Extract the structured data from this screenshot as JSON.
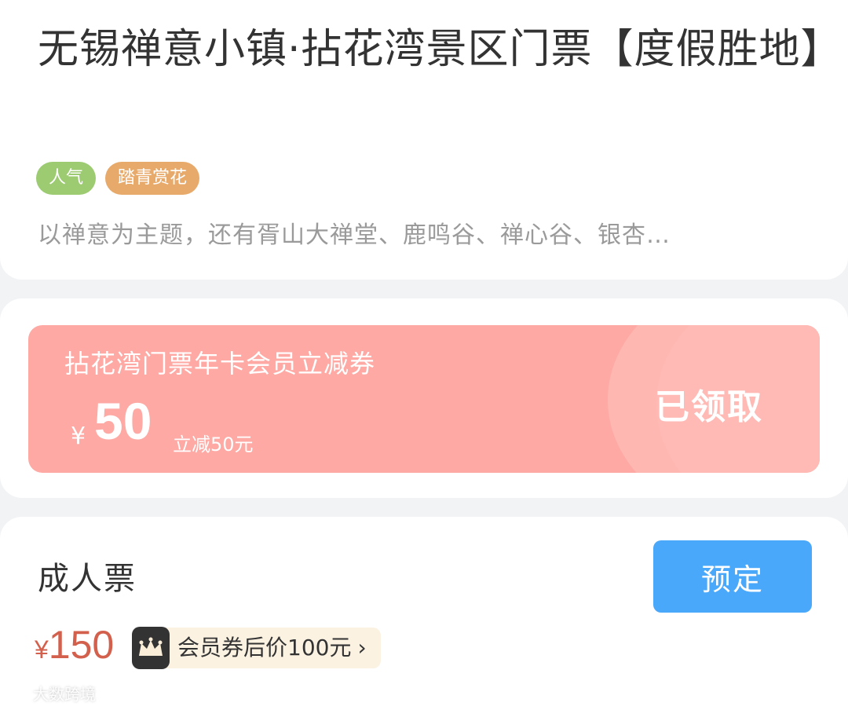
{
  "product": {
    "title": "无锡禅意小镇·拈花湾景区门票【度假胜地】",
    "tags": [
      "人气",
      "踏青赏花"
    ],
    "description": "以禅意为主题，还有胥山大禅堂、鹿鸣谷、禅心谷、银杏…"
  },
  "coupon": {
    "title": "拈花湾门票年卡会员立减券",
    "currency": "¥",
    "amount": "50",
    "note": "立减50元",
    "status": "已领取"
  },
  "ticket": {
    "name": "成人票",
    "book_label": "预定",
    "price_currency": "¥",
    "price_value": "150",
    "member_price_text": "会员券后价100元",
    "member_icon": "crown-icon",
    "chevron_icon": "chevron-right-icon"
  },
  "watermark": "大数跨境",
  "colors": {
    "coupon_bg": "#fea9a4",
    "book_button": "#4aa8fa",
    "price": "#d3604c",
    "tag_green": "#9ccb72",
    "tag_orange": "#e8aa6a"
  }
}
